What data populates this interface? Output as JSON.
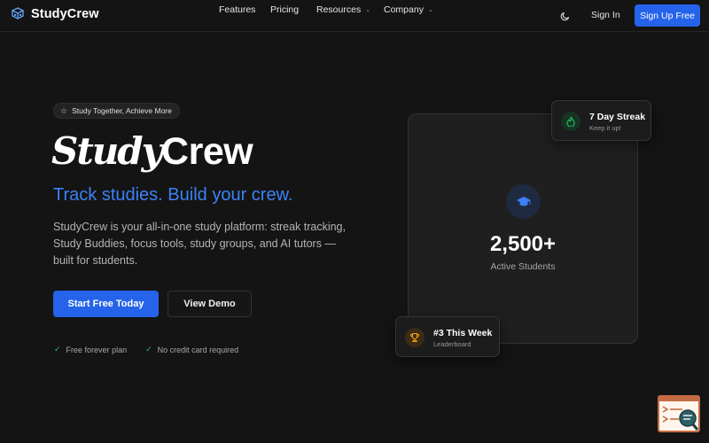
{
  "brand": {
    "name": "StudyCrew"
  },
  "nav": {
    "links": [
      {
        "label": "Features",
        "dropdown": false
      },
      {
        "label": "Pricing",
        "dropdown": false
      },
      {
        "label": "Resources",
        "dropdown": true
      },
      {
        "label": "Company",
        "dropdown": true
      }
    ],
    "sign_in": "Sign In",
    "sign_up": "Sign Up Free"
  },
  "hero": {
    "badge": "Study Together, Achieve More",
    "title_script": "Study",
    "title_plain": "Crew",
    "tagline": "Track studies. Build your crew.",
    "description": "StudyCrew is your all-in-one study platform: streak tracking, Study Buddies, focus tools, study groups, and AI tutors — built for students.",
    "primary_cta": "Start Free Today",
    "secondary_cta": "View Demo",
    "checks": [
      "Free forever plan",
      "No credit card required"
    ]
  },
  "stats_card": {
    "value": "2,500+",
    "label": "Active Students"
  },
  "streak_card": {
    "title": "7 Day Streak",
    "subtitle": "Keep it up!"
  },
  "rank_card": {
    "title": "#3 This Week",
    "subtitle": "Leaderboard"
  },
  "icons": {
    "logo": "graduation-cubes-icon",
    "theme": "moon-icon",
    "badge": "star-icon",
    "check": "check-icon",
    "stat": "graduation-cap-icon",
    "streak": "flame-icon",
    "rank": "trophy-icon"
  },
  "colors": {
    "background": "#141414",
    "accent": "#2563eb",
    "tagline": "#3b82f6",
    "success": "#22c55e",
    "trophy": "#f59e0b"
  }
}
